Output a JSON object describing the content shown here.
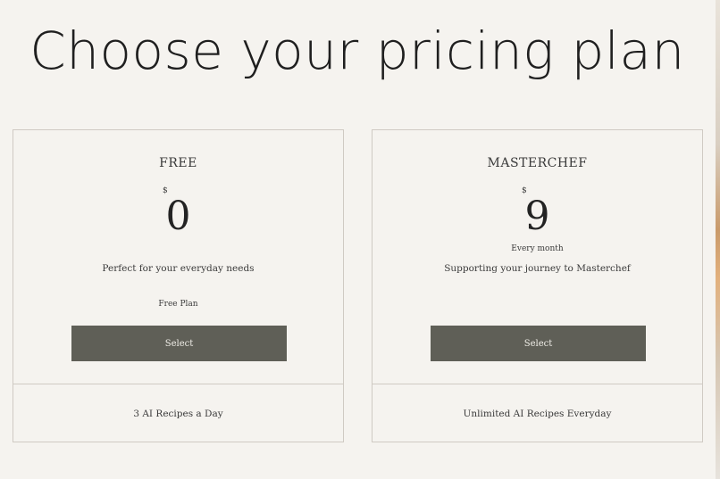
{
  "page": {
    "title": "Choose your pricing plan"
  },
  "plans": [
    {
      "name": "FREE",
      "currency": "$",
      "price": "0",
      "period": "",
      "description": "Perfect for your everyday needs",
      "note": "Free Plan",
      "button_label": "Select",
      "feature": "3 AI Recipes a Day"
    },
    {
      "name": "MASTERCHEF",
      "currency": "$",
      "price": "9",
      "period": "Every month",
      "description": "Supporting your journey to Masterchef",
      "note": "",
      "button_label": "Select",
      "feature": "Unlimited AI Recipes Everyday"
    }
  ],
  "colors": {
    "background": "#f5f3ef",
    "button": "#5f5f57",
    "border": "#cfcac3"
  }
}
